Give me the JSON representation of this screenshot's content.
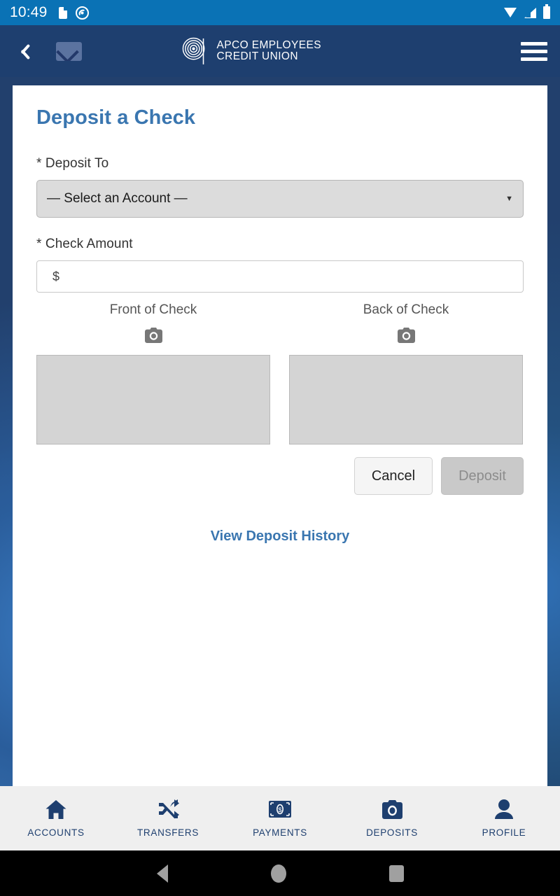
{
  "status_bar": {
    "time": "10:49",
    "icons": [
      "sd-card-icon",
      "nfc-icon",
      "wifi-icon",
      "cellular-signal-icon",
      "battery-icon"
    ]
  },
  "app_bar": {
    "back_icon": "back-chevron-icon",
    "mail_icon": "mail-envelope-icon",
    "menu_icon": "hamburger-menu-icon",
    "brand_line1": "APCO EMPLOYEES",
    "brand_line2": "CREDIT UNION",
    "brand_mark": "spiral-logo-icon",
    "bg_color": "#1e3f6f"
  },
  "page": {
    "title": "Deposit a Check",
    "title_color": "#3a76b0"
  },
  "form": {
    "deposit_to_label": "* Deposit To",
    "account_select_value": "— Select an Account —",
    "select_caret_icon": "chevron-down-icon",
    "check_amount_label": "* Check Amount",
    "check_amount_value": "",
    "check_amount_placeholder": "$",
    "front_label": "Front of Check",
    "back_label": "Back of Check",
    "camera_icon": "camera-icon"
  },
  "actions": {
    "cancel_label": "Cancel",
    "deposit_label": "Deposit",
    "deposit_disabled": true,
    "history_link": "View Deposit History",
    "link_color": "#3a76b0"
  },
  "tab_bar": {
    "items": [
      {
        "label": "ACCOUNTS",
        "icon": "home-icon"
      },
      {
        "label": "TRANSFERS",
        "icon": "shuffle-arrows-icon"
      },
      {
        "label": "PAYMENTS",
        "icon": "banknote-icon"
      },
      {
        "label": "DEPOSITS",
        "icon": "camera-icon"
      },
      {
        "label": "PROFILE",
        "icon": "person-icon"
      }
    ],
    "accent_color": "#1e3f6f",
    "bg_color": "#efefef"
  },
  "system_nav": {
    "back_icon": "android-back-icon",
    "home_icon": "android-home-icon",
    "recents_icon": "android-recents-icon"
  }
}
